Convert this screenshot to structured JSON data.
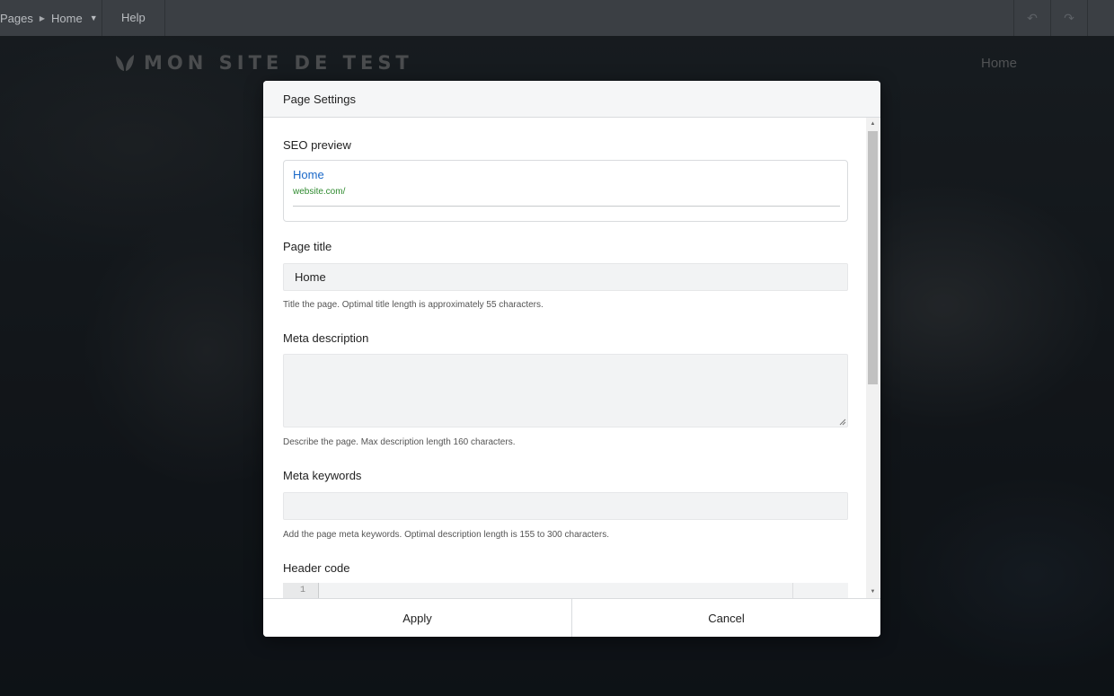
{
  "topbar": {
    "crumb_root": "Pages",
    "crumb_current": "Home",
    "help_label": "Help",
    "undo_icon": "undo-icon",
    "redo_icon": "redo-icon"
  },
  "site": {
    "logo_text": "MON SITE DE TEST",
    "nav_home": "Home"
  },
  "modal": {
    "title": "Page Settings",
    "seo": {
      "label": "SEO preview",
      "preview_title": "Home",
      "preview_url": "website.com/"
    },
    "page_title": {
      "label": "Page title",
      "value": "Home",
      "hint": "Title the page. Optimal title length is approximately 55 characters."
    },
    "meta_description": {
      "label": "Meta description",
      "value": "",
      "hint": "Describe the page. Max description length 160 characters."
    },
    "meta_keywords": {
      "label": "Meta keywords",
      "value": "",
      "hint": "Add the page meta keywords. Optimal description length is 155 to 300 characters."
    },
    "header_code": {
      "label": "Header code",
      "line_number": "1"
    },
    "apply_label": "Apply",
    "cancel_label": "Cancel"
  },
  "colors": {
    "link": "#1a68c8",
    "url": "#2f8a2f",
    "topbar": "#3b3f44"
  }
}
